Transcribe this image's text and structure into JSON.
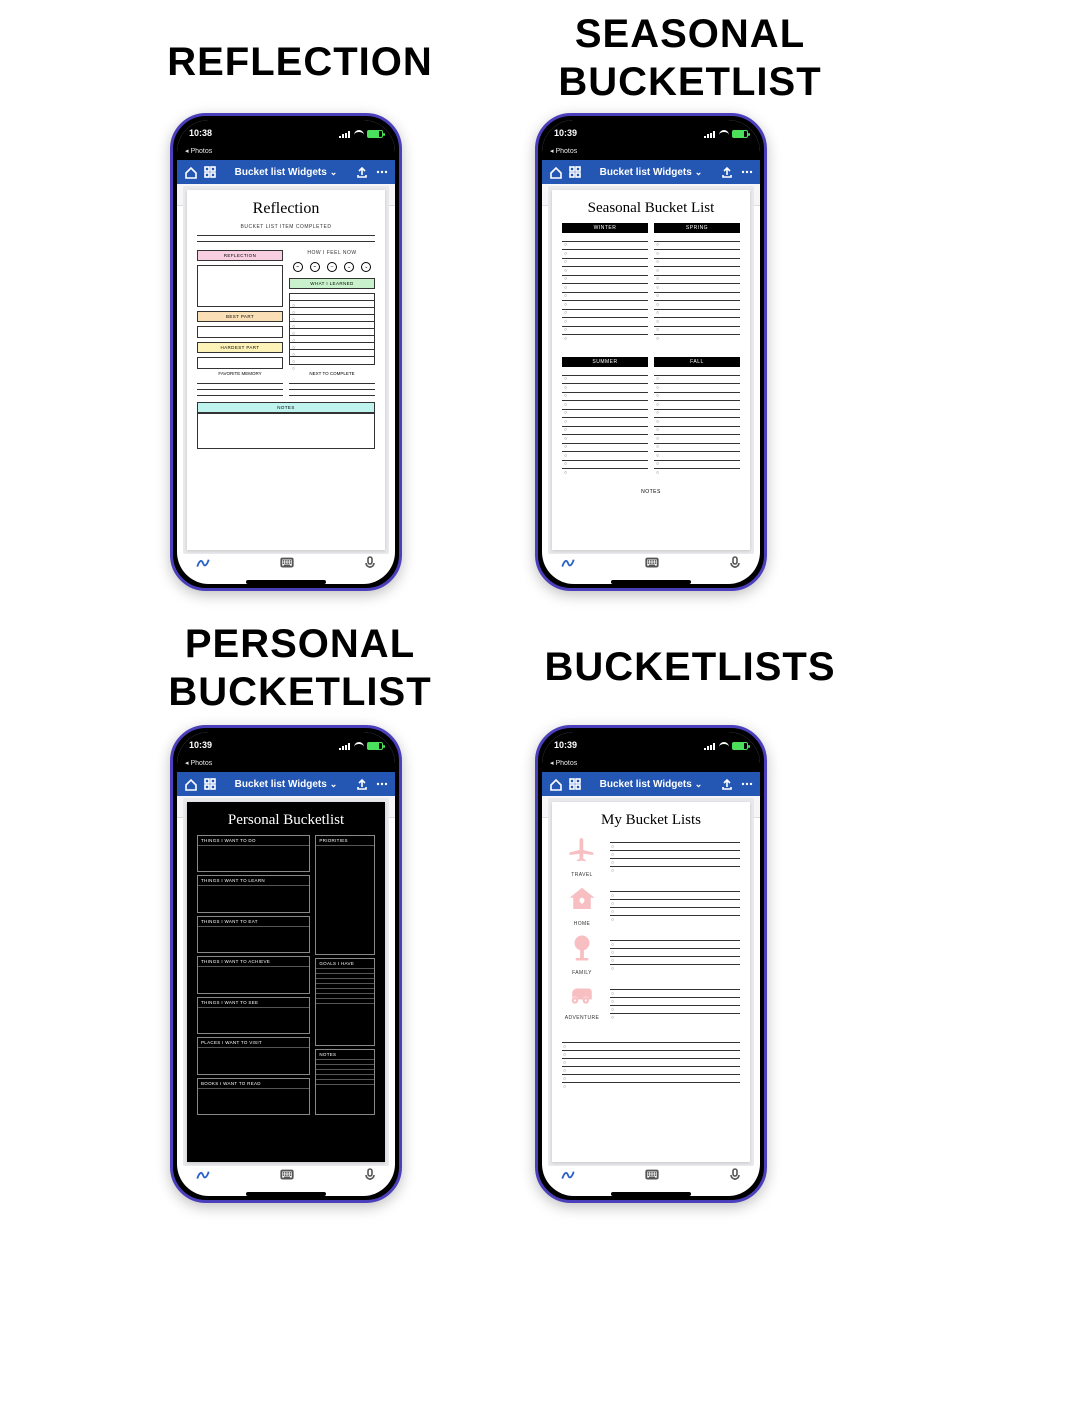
{
  "labels": {
    "reflection": "REFLECTION",
    "seasonal": "SEASONAL BUCKETLIST",
    "personal": "PERSONAL BUCKETLIST",
    "bucketlists": "BUCKETLISTS"
  },
  "phones": [
    {
      "time": "10:38",
      "back": "◂ Photos",
      "doc_title": "Bucket list Widgets"
    },
    {
      "time": "10:39",
      "back": "◂ Photos",
      "doc_title": "Bucket list Widgets"
    },
    {
      "time": "10:39",
      "back": "◂ Photos",
      "doc_title": "Bucket list Widgets"
    },
    {
      "time": "10:39",
      "back": "◂ Photos",
      "doc_title": "Bucket list Widgets"
    }
  ],
  "page_reflection": {
    "title": "Reflection",
    "subtitle": "BUCKET LIST ITEM COMPLETED",
    "sections": {
      "reflection": "REFLECTION",
      "feel": "HOW I FEEL NOW",
      "learned": "WHAT I LEARNED",
      "best": "BEST PART",
      "hardest": "HARDEST PART",
      "memory": "FAVORITE MEMORY",
      "next": "NEXT TO COMPLETE",
      "notes": "NOTES"
    },
    "colors": {
      "reflection": "#f8cfe0",
      "learned": "#c9f2cc",
      "best": "#fadfb6",
      "hardest": "#fdf3b8",
      "notes": "#bff3ee"
    }
  },
  "page_seasonal": {
    "title": "Seasonal Bucket List",
    "seasons": [
      "WINTER",
      "SPRING",
      "SUMMER",
      "FALL"
    ],
    "notes": "NOTES"
  },
  "page_personal": {
    "title": "Personal Bucketlist",
    "left": [
      "THINGS I WANT TO DO",
      "THINGS I WANT TO LEARN",
      "THINGS I WANT TO EAT",
      "THINGS I WANT TO ACHIEVE",
      "THINGS I WANT TO SEE",
      "PLACES I WANT TO VISIT",
      "BOOKS I WANT TO READ"
    ],
    "right": {
      "priorities": "PRIORITIES",
      "goals": "GOALS I HAVE",
      "notes": "NOTES"
    }
  },
  "page_bucketlists": {
    "title": "My Bucket Lists",
    "categories": [
      "TRAVEL",
      "HOME",
      "FAMILY",
      "ADVENTURE"
    ]
  }
}
